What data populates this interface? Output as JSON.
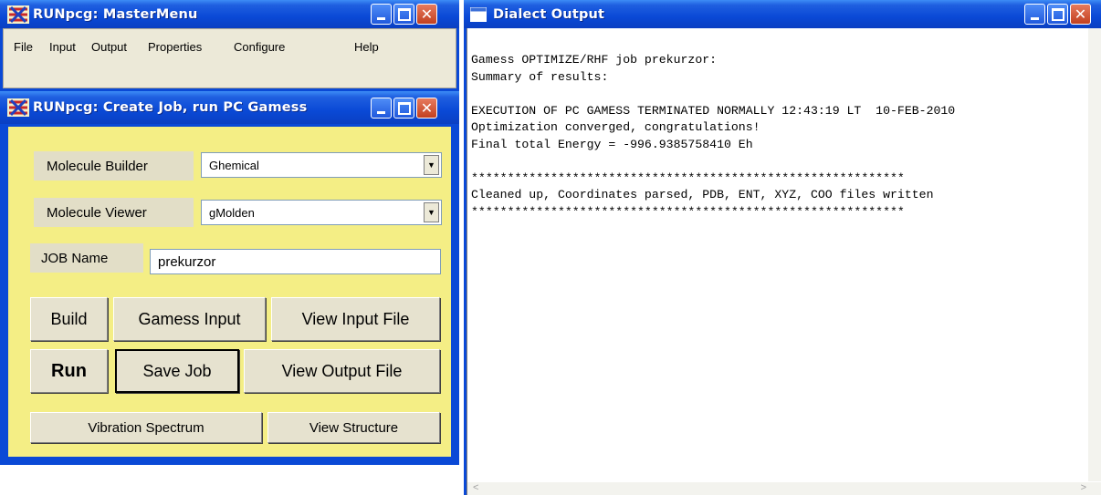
{
  "master": {
    "title": "RUNpcg: MasterMenu",
    "menu": [
      "File",
      "Input",
      "Output",
      "Properties",
      "Configure",
      "Help"
    ]
  },
  "createjob": {
    "title": "RUNpcg: Create Job, run PC Gamess",
    "molecule_builder_label": "Molecule Builder",
    "molecule_builder_value": "Ghemical",
    "molecule_viewer_label": "Molecule Viewer",
    "molecule_viewer_value": "gMolden",
    "job_name_label": "JOB Name",
    "job_name_value": "prekurzor",
    "buttons": {
      "build": "Build",
      "gamess_input": "Gamess Input",
      "view_input": "View Input File",
      "run": "Run",
      "save_job": "Save Job",
      "view_output": "View Output File",
      "vibration": "Vibration Spectrum",
      "view_structure": "View Structure"
    }
  },
  "dialect": {
    "title": "Dialect Output",
    "lines": [
      "Gamess OPTIMIZE/RHF job prekurzor:",
      "Summary of results:",
      "",
      "EXECUTION OF PC GAMESS TERMINATED NORMALLY 12:43:19 LT  10-FEB-2010",
      "Optimization converged, congratulations!",
      "Final total Energy = -996.9385758410 Eh",
      "",
      "************************************************************",
      "Cleaned up, Coordinates parsed, PDB, ENT, XYZ, COO files written",
      "************************************************************"
    ]
  }
}
